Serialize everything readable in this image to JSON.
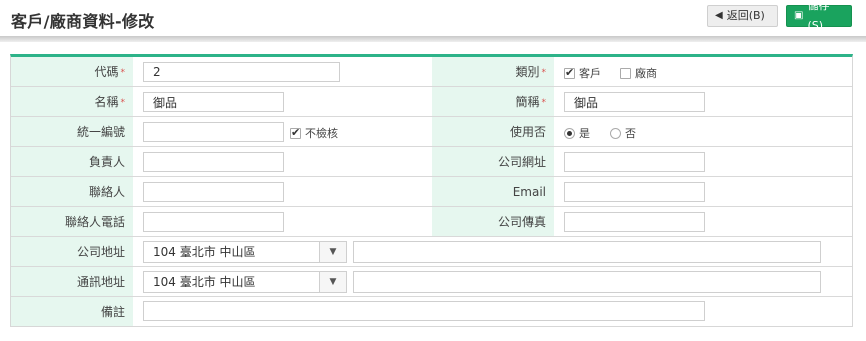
{
  "header": {
    "title": "客戶/廠商資料-修改",
    "back_label": "返回(B)",
    "save_label": "儲存(S)",
    "back_icon": "arrow-left-icon",
    "save_icon": "floppy-disk-icon"
  },
  "colors": {
    "accent": "#2db389",
    "label_bg": "#e6f7ef",
    "save_button": "#1aa35e",
    "required_mark": "#d9534f"
  },
  "required_mark": "*",
  "form": {
    "code": {
      "label": "代碼",
      "value": "2"
    },
    "category": {
      "label": "類別",
      "options": [
        {
          "label": "客戶",
          "checked": true
        },
        {
          "label": "廠商",
          "checked": false
        }
      ]
    },
    "name": {
      "label": "名稱",
      "value": "御品"
    },
    "short_name": {
      "label": "簡稱",
      "value": "御品"
    },
    "tax_id": {
      "label": "統一編號",
      "value": "",
      "no_check_label": "不檢核",
      "no_check_checked": true
    },
    "in_use": {
      "label": "使用否",
      "options": [
        {
          "label": "是",
          "selected": true
        },
        {
          "label": "否",
          "selected": false
        }
      ]
    },
    "owner": {
      "label": "負責人",
      "value": ""
    },
    "website": {
      "label": "公司網址",
      "value": ""
    },
    "contact": {
      "label": "聯絡人",
      "value": ""
    },
    "email": {
      "label": "Email",
      "value": ""
    },
    "contact_phone": {
      "label": "聯絡人電話",
      "value": ""
    },
    "fax": {
      "label": "公司傳真",
      "value": ""
    },
    "company_address": {
      "label": "公司地址",
      "district": "104 臺北市 中山區",
      "street": ""
    },
    "mailing_address": {
      "label": "通訊地址",
      "district": "104 臺北市 中山區",
      "street": ""
    },
    "notes": {
      "label": "備註",
      "value": ""
    }
  }
}
